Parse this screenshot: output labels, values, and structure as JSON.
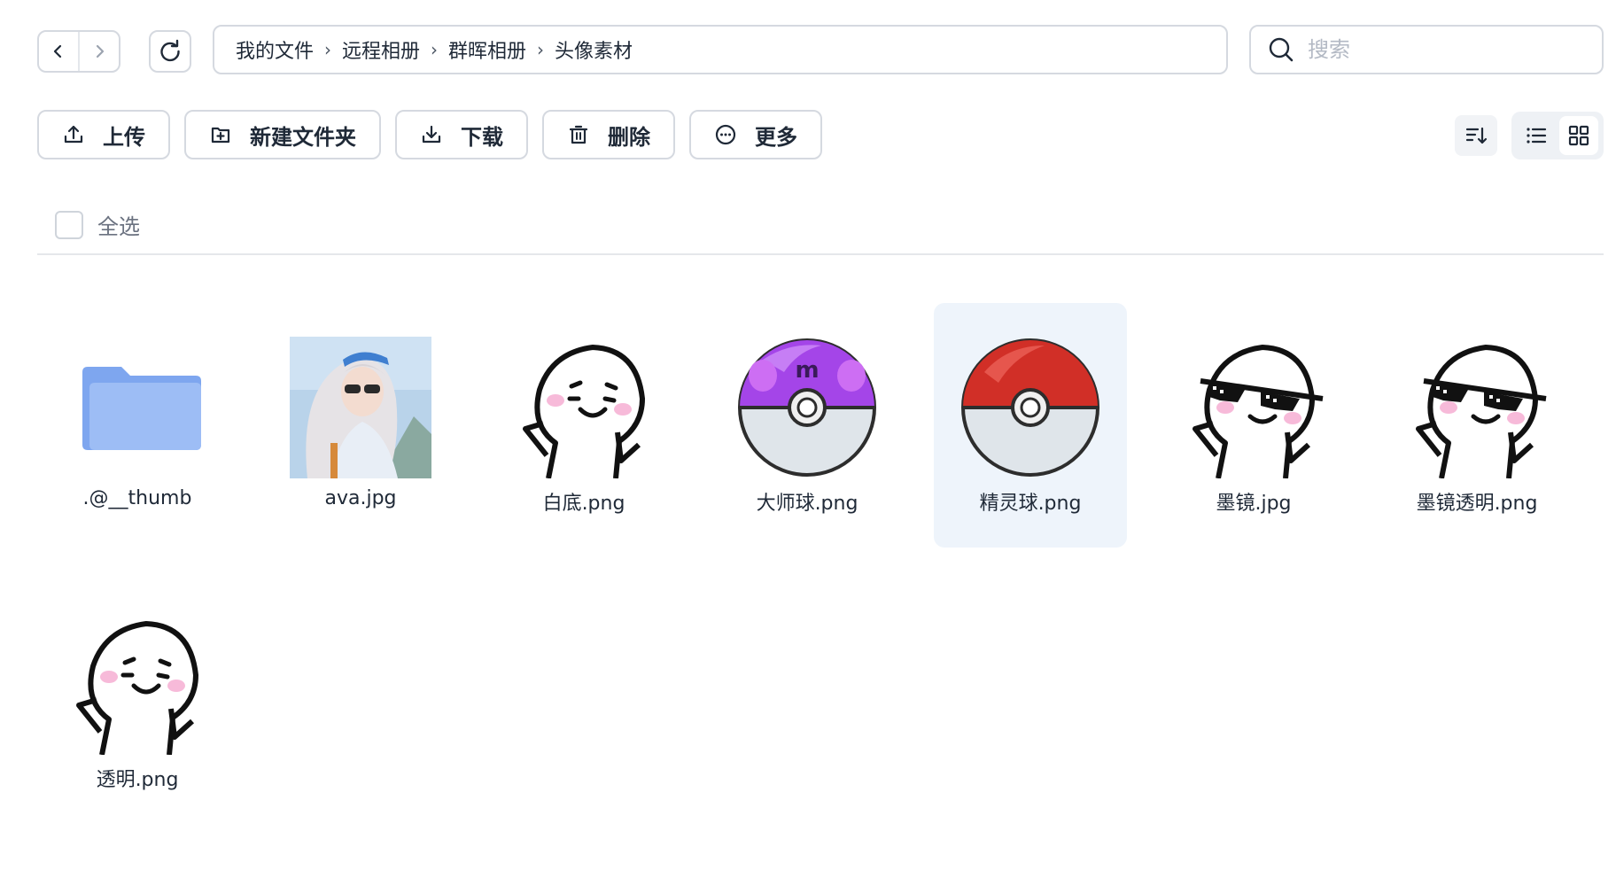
{
  "breadcrumb": [
    "我的文件",
    "远程相册",
    "群晖相册",
    "头像素材"
  ],
  "search": {
    "placeholder": "搜索"
  },
  "toolbar": {
    "upload": "上传",
    "new_folder": "新建文件夹",
    "download": "下载",
    "delete": "删除",
    "more": "更多"
  },
  "select_all": "全选",
  "files": [
    {
      "name": ".@__thumb",
      "kind": "folder"
    },
    {
      "name": "ava.jpg",
      "kind": "photo"
    },
    {
      "name": "白底.png",
      "kind": "meme"
    },
    {
      "name": "大师球.png",
      "kind": "master-ball"
    },
    {
      "name": "精灵球.png",
      "kind": "poke-ball",
      "selected": true
    },
    {
      "name": "墨镜.jpg",
      "kind": "meme-sunglasses"
    },
    {
      "name": "墨镜透明.png",
      "kind": "meme-sunglasses"
    },
    {
      "name": "透明.png",
      "kind": "meme"
    }
  ],
  "colors": {
    "accent": "#2f7bf5",
    "folder": "#8fb3f2",
    "selected_bg": "#eef4fb"
  }
}
